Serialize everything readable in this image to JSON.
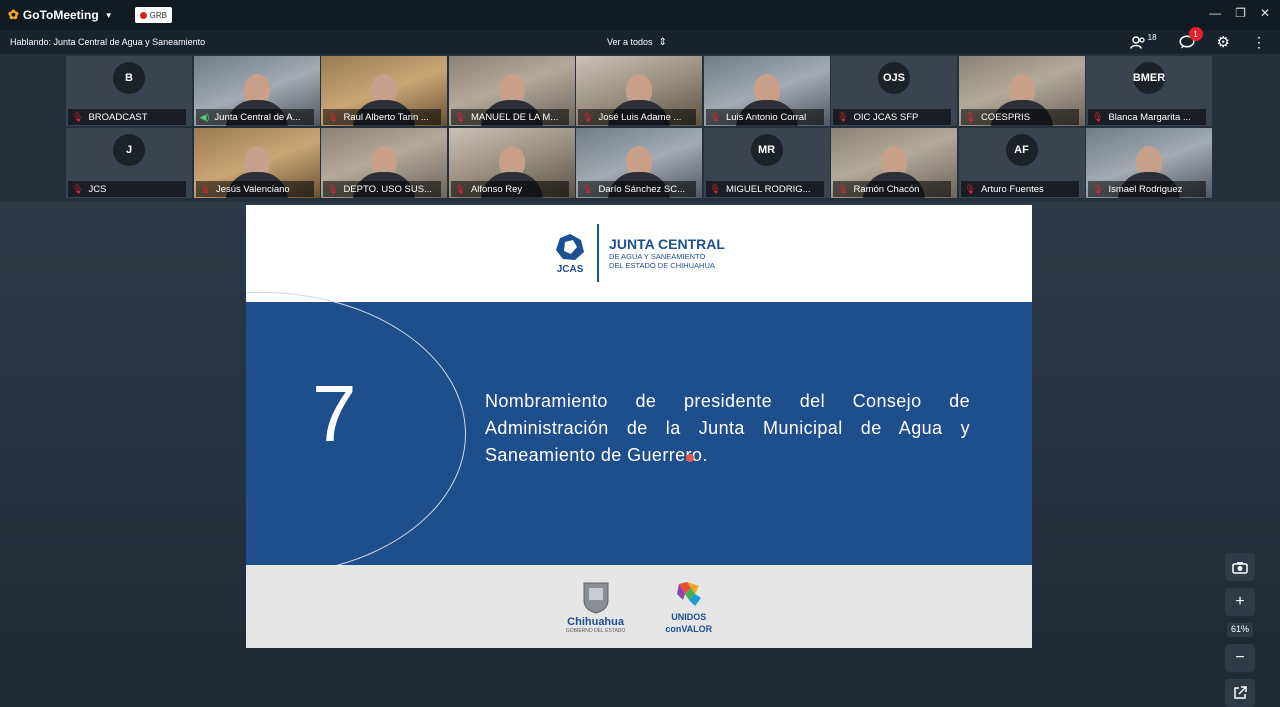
{
  "app": {
    "name": "GoToMeeting",
    "rec_label": "GRB"
  },
  "header": {
    "speaking": "Hablando: Junta Central de Agua y Saneamiento",
    "view_all": "Ver a todos",
    "participants_count": "18",
    "chat_badge": "1"
  },
  "participants": [
    {
      "name": "BROADCAST",
      "initials": "B",
      "mic": "muted",
      "video": false
    },
    {
      "name": "Junta Central de A...",
      "initials": "",
      "mic": "on",
      "video": true
    },
    {
      "name": "Raul Alberto Tarin ...",
      "initials": "",
      "mic": "muted",
      "video": true
    },
    {
      "name": "MANUEL DE LA M...",
      "initials": "",
      "mic": "muted",
      "video": true
    },
    {
      "name": "José Luis Adame ...",
      "initials": "",
      "mic": "muted",
      "video": true
    },
    {
      "name": "Luis Antonio Corral",
      "initials": "",
      "mic": "muted",
      "video": true
    },
    {
      "name": "OIC JCAS SFP",
      "initials": "OJS",
      "mic": "muted",
      "video": false
    },
    {
      "name": "COESPRIS",
      "initials": "",
      "mic": "muted",
      "video": true
    },
    {
      "name": "Blanca Margarita ...",
      "initials": "BMER",
      "mic": "muted",
      "video": false
    },
    {
      "name": "JCS",
      "initials": "J",
      "mic": "muted",
      "video": false
    },
    {
      "name": "Jesús Valenciano",
      "initials": "",
      "mic": "muted",
      "video": true
    },
    {
      "name": "DEPTO. USO SUS...",
      "initials": "",
      "mic": "muted",
      "video": true
    },
    {
      "name": "Alfonso Rey",
      "initials": "",
      "mic": "muted",
      "video": true
    },
    {
      "name": "Darío Sánchez SC...",
      "initials": "",
      "mic": "muted",
      "video": true
    },
    {
      "name": "MIGUEL RODRIG...",
      "initials": "MR",
      "mic": "muted",
      "video": false
    },
    {
      "name": "Ramón Chacón",
      "initials": "",
      "mic": "muted",
      "video": true
    },
    {
      "name": "Arturo Fuentes",
      "initials": "AF",
      "mic": "muted",
      "video": false
    },
    {
      "name": "Ismael Rodriguez",
      "initials": "",
      "mic": "muted",
      "video": true
    }
  ],
  "slide": {
    "org_abbr": "JCAS",
    "org_title": "JUNTA CENTRAL",
    "org_sub1": "DE AGUA Y SANEAMIENTO",
    "org_sub2": "DEL ESTADO DE CHIHUAHUA",
    "number": "7",
    "text": "Nombramiento de presidente del Consejo de Administración de la Junta Municipal de Agua y Saneamiento de Guerrero.",
    "footer_left": "Chihuahua",
    "footer_left_sub": "GOBIERNO DEL ESTADO",
    "footer_right_1": "UNIDOS",
    "footer_right_2": "conVALOR"
  },
  "zoom": {
    "level": "61%"
  },
  "colors": {
    "slide_blue": "#1f4e8c",
    "muted_mic": "#e3222f",
    "active_mic": "#4bd16a"
  }
}
